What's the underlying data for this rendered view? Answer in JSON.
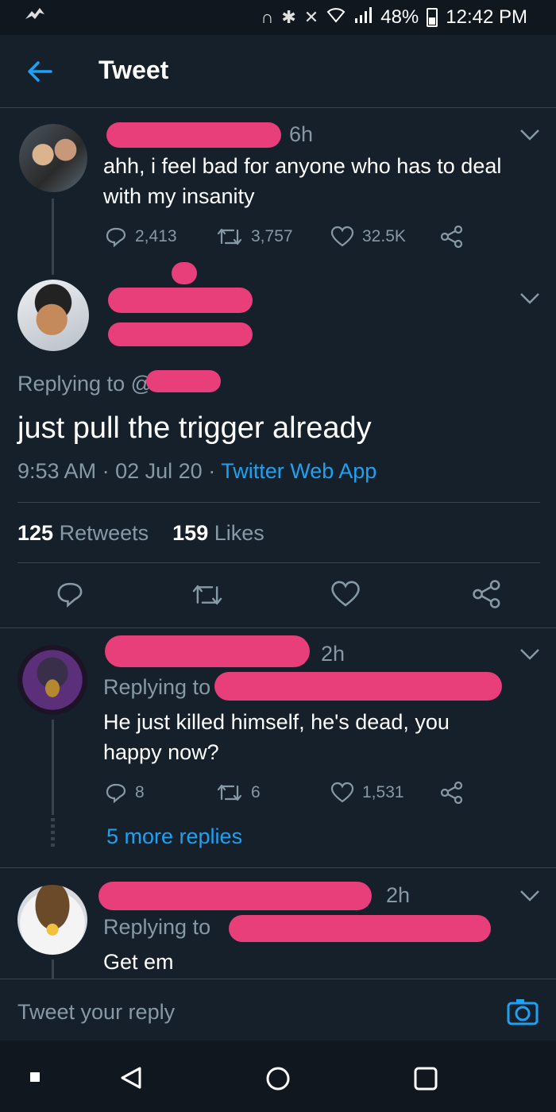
{
  "status_bar": {
    "battery": "48%",
    "time": "12:42 PM"
  },
  "header": {
    "title": "Tweet"
  },
  "parent_tweet": {
    "time": "6h",
    "text_line1": "ahh, i feel bad for anyone who has to deal",
    "text_line2": "with my insanity",
    "replies": "2,413",
    "retweets": "3,757",
    "likes": "32.5K"
  },
  "main_tweet": {
    "replying_to": "Replying to @",
    "text": "just pull the trigger already",
    "time": "9:53 AM",
    "date": "02 Jul 20",
    "source": "Twitter Web App",
    "retweets_count": "125",
    "retweets_label": "Retweets",
    "likes_count": "159",
    "likes_label": "Likes"
  },
  "reply1": {
    "time": "2h",
    "replying_to": "Replying to @",
    "text_line1": "He just killed himself, he's dead, you",
    "text_line2": "happy now?",
    "replies": "8",
    "retweets": "6",
    "likes": "1,531",
    "more_replies": "5 more replies"
  },
  "reply2": {
    "time": "2h",
    "replying_to": "Replying to",
    "text": "Get em"
  },
  "reply_bar": {
    "placeholder": "Tweet your reply"
  },
  "colors": {
    "background": "#15202b",
    "accent": "#1da1f2",
    "muted": "#8899a6",
    "redaction": "#e83e7a"
  }
}
